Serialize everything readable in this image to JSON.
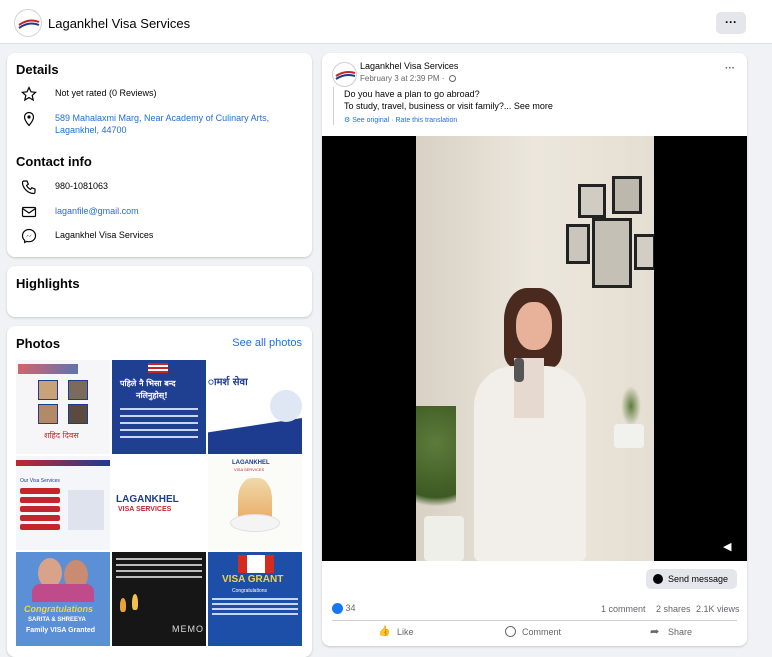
{
  "topbar": {
    "page_name": "Lagankhel Visa Services",
    "more_label": "···"
  },
  "details": {
    "title": "Details",
    "rating": "Not yet rated (0 Reviews)",
    "address": "589 Mahalaxmi Marg, Near Academy of Culinary Arts,",
    "address2": "Lagankhel, 44700"
  },
  "contact": {
    "title": "Contact info",
    "phone": "980-1081063",
    "email": "laganfile@gmail.com",
    "messenger": "Lagankhel Visa Services"
  },
  "highlights": {
    "title": "Highlights"
  },
  "photos": {
    "title": "Photos",
    "see_all": "See all photos",
    "tiles": [
      {
        "text": "शहिद दिवस"
      },
      {
        "text": "पहिले नै भिसा बन्द",
        "text2": "नलिनुहोस्!"
      },
      {
        "text": "ामर्श सेवा"
      },
      {
        "text": "Our Visa Services"
      },
      {
        "text": "LAGANKHEL",
        "text2": "VISA SERVICES"
      },
      {
        "text": "LAGANKHEL",
        "text2": "VISA SERVICES"
      },
      {
        "text": "Congratulations",
        "text2": "SARITA & SHREEYA",
        "text3": "Family VISA Granted"
      },
      {
        "text": "MEMO"
      },
      {
        "text": "VISA GRANT",
        "text2": "Congratulations"
      }
    ]
  },
  "post": {
    "author": "Lagankhel Visa Services",
    "meta": "February 3 at 2:39 PM ·",
    "line1": "Do you have a plan to go abroad?",
    "line2": "To study, travel, business or visit family?... See more",
    "see_original": "See original",
    "separator": " · ",
    "rate_translation": "Rate this translation",
    "more_label": "···",
    "send_message": "Send message",
    "reactions": "34",
    "comments": "1 comment",
    "shares": "2 shares",
    "views": "2.1K views",
    "like": "Like",
    "comment": "Comment",
    "share": "Share"
  },
  "colors": {
    "link": "#216fdb",
    "bg": "#f0f2f5",
    "accent": "#1877f2"
  }
}
